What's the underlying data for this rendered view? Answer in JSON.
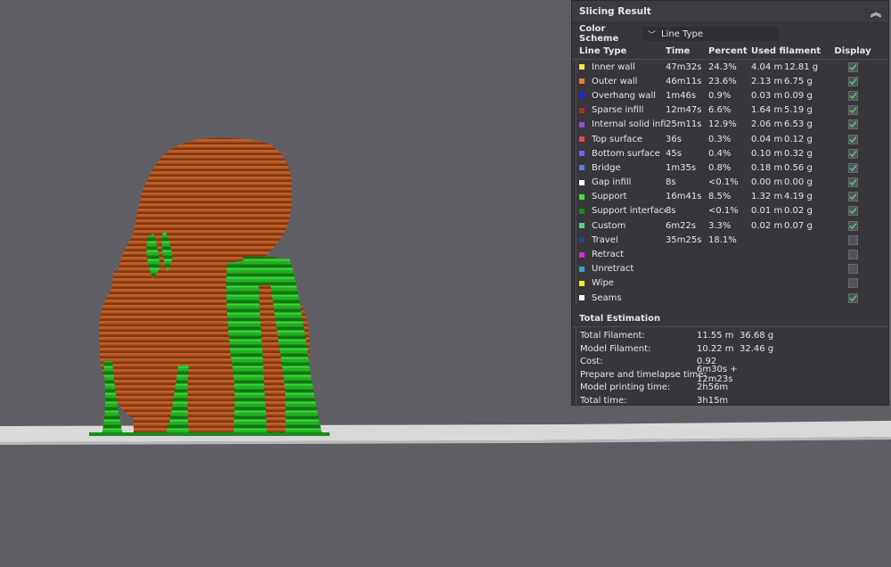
{
  "colors": {
    "background": "#5f5e64",
    "model_orange": "#b3541f",
    "support_green": "#22b022",
    "build_plate": "#d9d9d9",
    "panel_bg": "#36363b"
  },
  "panel": {
    "title": "Slicing Result",
    "collapse_icon": "chevron-up-icon",
    "color_scheme_label": "Color Scheme",
    "color_scheme_value": "Line Type",
    "columns": {
      "type": "Line Type",
      "time": "Time",
      "percent": "Percent",
      "used": "Used filament",
      "display": "Display"
    },
    "rows": [
      {
        "name": "Inner wall",
        "color": "#f2e64a",
        "time": "47m32s",
        "percent": "24.3%",
        "meters": "4.04 m",
        "grams": "12.81 g",
        "display": true
      },
      {
        "name": "Outer wall",
        "color": "#f07c30",
        "time": "46m11s",
        "percent": "23.6%",
        "meters": "2.13 m",
        "grams": "6.75 g",
        "display": true
      },
      {
        "name": "Overhang wall",
        "color": "#2222ff",
        "time": "1m46s",
        "percent": "0.9%",
        "meters": "0.03 m",
        "grams": "0.09 g",
        "display": true
      },
      {
        "name": "Sparse infill",
        "color": "#b03028",
        "time": "12m47s",
        "percent": "6.6%",
        "meters": "1.64 m",
        "grams": "5.19 g",
        "display": true
      },
      {
        "name": "Internal solid infill",
        "color": "#9a4ec8",
        "time": "25m11s",
        "percent": "12.9%",
        "meters": "2.06 m",
        "grams": "6.53 g",
        "display": true
      },
      {
        "name": "Top surface",
        "color": "#e84848",
        "time": "36s",
        "percent": "0.3%",
        "meters": "0.04 m",
        "grams": "0.12 g",
        "display": true
      },
      {
        "name": "Bottom surface",
        "color": "#6a6ae8",
        "time": "45s",
        "percent": "0.4%",
        "meters": "0.10 m",
        "grams": "0.32 g",
        "display": true
      },
      {
        "name": "Bridge",
        "color": "#5a7ed0",
        "time": "1m35s",
        "percent": "0.8%",
        "meters": "0.18 m",
        "grams": "0.56 g",
        "display": true
      },
      {
        "name": "Gap infill",
        "color": "#ffffff",
        "time": "8s",
        "percent": "<0.1%",
        "meters": "0.00 m",
        "grams": "0.00 g",
        "display": true
      },
      {
        "name": "Support",
        "color": "#2ee82e",
        "time": "16m41s",
        "percent": "8.5%",
        "meters": "1.32 m",
        "grams": "4.19 g",
        "display": true
      },
      {
        "name": "Support interface",
        "color": "#1c8a1c",
        "time": "8s",
        "percent": "<0.1%",
        "meters": "0.01 m",
        "grams": "0.02 g",
        "display": true
      },
      {
        "name": "Custom",
        "color": "#5ecb8a",
        "time": "6m22s",
        "percent": "3.3%",
        "meters": "0.02 m",
        "grams": "0.07 g",
        "display": true
      },
      {
        "name": "Travel",
        "color": "#2c3e8a",
        "time": "35m25s",
        "percent": "18.1%",
        "meters": "",
        "grams": "",
        "display": false
      },
      {
        "name": "Retract",
        "color": "#d030d0",
        "time": "",
        "percent": "",
        "meters": "",
        "grams": "",
        "display": false
      },
      {
        "name": "Unretract",
        "color": "#3aa0c8",
        "time": "",
        "percent": "",
        "meters": "",
        "grams": "",
        "display": false
      },
      {
        "name": "Wipe",
        "color": "#f0f020",
        "time": "",
        "percent": "",
        "meters": "",
        "grams": "",
        "display": false
      },
      {
        "name": "Seams",
        "color": "#f4f4f4",
        "time": "",
        "percent": "",
        "meters": "",
        "grams": "",
        "display": true
      }
    ],
    "estimation_title": "Total Estimation",
    "estimation": [
      {
        "label": "Total Filament:",
        "v1": "11.55 m",
        "v2": "36.68 g"
      },
      {
        "label": "Model Filament:",
        "v1": "10.22 m",
        "v2": "32.46 g"
      },
      {
        "label": "Cost:",
        "v1": "0.92",
        "v2": ""
      },
      {
        "label": "Prepare and timelapse time:",
        "v1": "6m30s + 12m23s",
        "v2": ""
      },
      {
        "label": "Model printing time:",
        "v1": "2h56m",
        "v2": ""
      },
      {
        "label": "Total time:",
        "v1": "3h15m",
        "v2": ""
      }
    ]
  }
}
